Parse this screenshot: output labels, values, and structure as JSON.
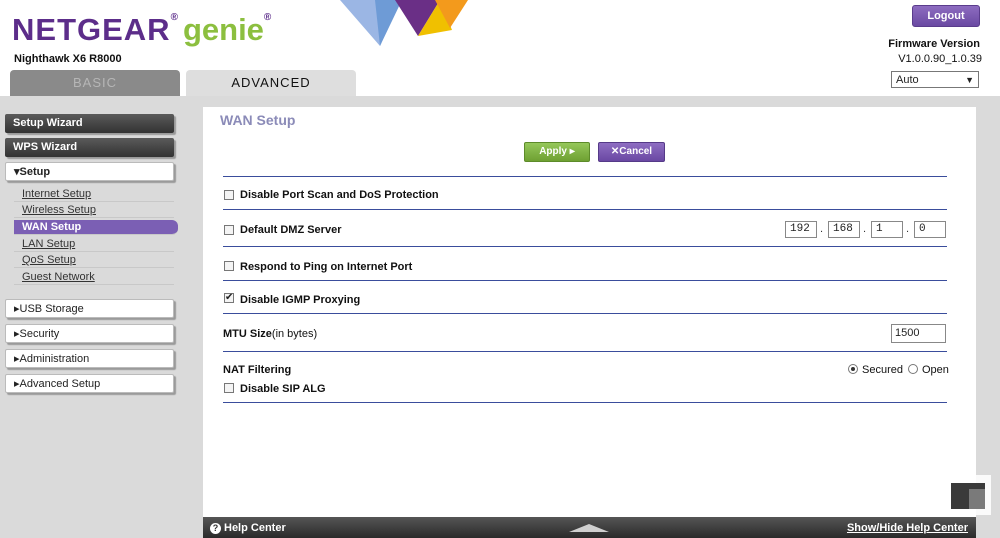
{
  "header": {
    "brand": "NETGEAR",
    "brand_reg": "®",
    "brand_suffix": "genie",
    "brand_suffix_reg": "®",
    "model": "Nighthawk X6 R8000",
    "logout_label": "Logout",
    "firmware_label": "Firmware Version",
    "firmware_value": "V1.0.0.90_1.0.39",
    "language_selected": "Auto",
    "tabs": [
      {
        "label": "BASIC",
        "active": false
      },
      {
        "label": "ADVANCED",
        "active": true
      }
    ]
  },
  "sidebar": {
    "setup_wizard": "Setup Wizard",
    "wps_wizard": "WPS Wizard",
    "setup": "Setup",
    "setup_items": [
      {
        "label": "Internet Setup",
        "active": false
      },
      {
        "label": "Wireless Setup",
        "active": false
      },
      {
        "label": "WAN Setup",
        "active": true
      },
      {
        "label": "LAN Setup",
        "active": false
      },
      {
        "label": "QoS Setup",
        "active": false
      },
      {
        "label": "Guest Network",
        "active": false
      }
    ],
    "usb_storage": "USB Storage",
    "security": "Security",
    "administration": "Administration",
    "advanced_setup": "Advanced Setup"
  },
  "main": {
    "title": "WAN Setup",
    "apply_label": "Apply",
    "cancel_label": "Cancel",
    "disable_port_scan": {
      "label": "Disable Port Scan and DoS Protection",
      "checked": false
    },
    "dmz": {
      "label": "Default DMZ Server",
      "checked": false,
      "ip": [
        "192",
        "168",
        "1",
        "0"
      ]
    },
    "respond_ping": {
      "label": "Respond to Ping on Internet Port",
      "checked": false
    },
    "disable_igmp": {
      "label": "Disable IGMP Proxying",
      "checked": true
    },
    "mtu": {
      "label": "MTU Size",
      "unit": "(in bytes)",
      "value": "1500"
    },
    "nat": {
      "label": "NAT Filtering",
      "options": [
        "Secured",
        "Open"
      ],
      "selected": "Secured"
    },
    "disable_sip": {
      "label": "Disable SIP ALG",
      "checked": false
    }
  },
  "footer": {
    "help_center": "Help Center",
    "show_hide": "Show/Hide Help Center"
  },
  "colors": {
    "purple": "#7b5fb4",
    "green": "#8cbf3f",
    "separator": "#3a4d9c"
  }
}
